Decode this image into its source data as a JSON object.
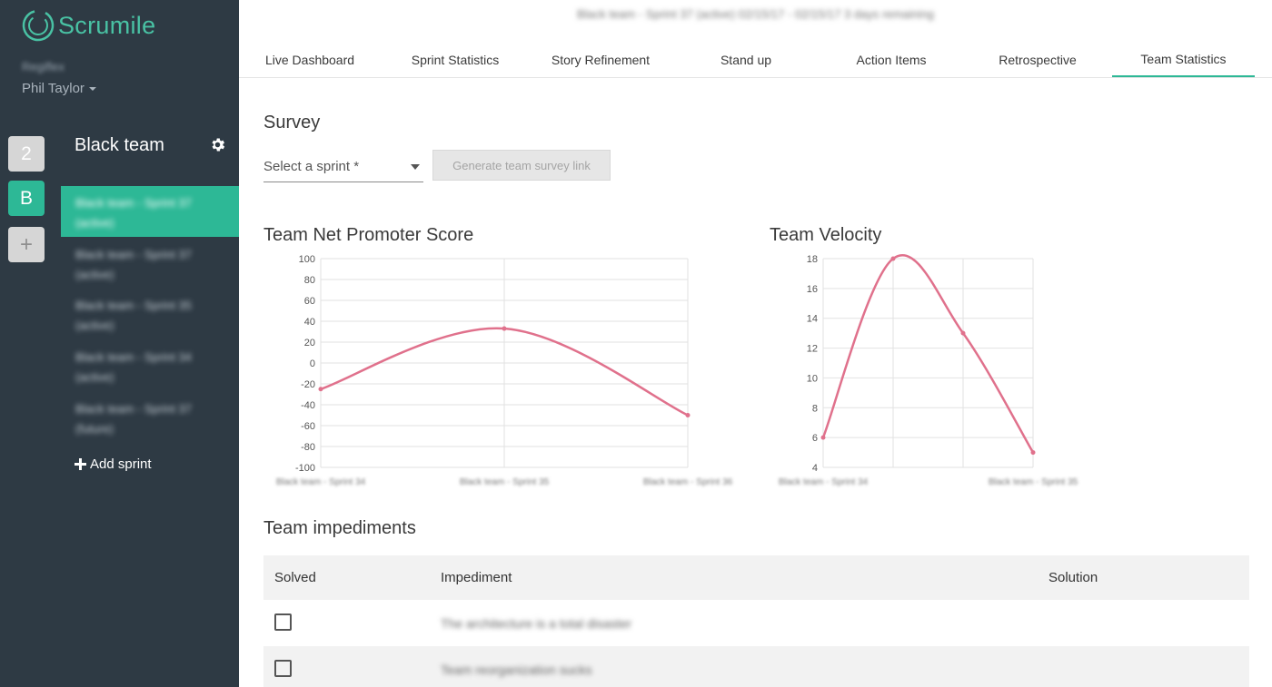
{
  "app": {
    "name": "Scrumile",
    "user_org": "Regiflex",
    "user_name": "Phil Taylor"
  },
  "rail": {
    "buttons": [
      "2",
      "B",
      "+"
    ]
  },
  "sidebar": {
    "team_name": "Black team",
    "sprints": [
      {
        "label": "Black team - Sprint 37 (active)"
      },
      {
        "label": "Black team - Sprint 37 (active)"
      },
      {
        "label": "Black team - Sprint 35 (active)"
      },
      {
        "label": "Black team - Sprint 34 (active)"
      },
      {
        "label": "Black team - Sprint 37 (future)"
      }
    ],
    "add_sprint": "Add sprint"
  },
  "header": {
    "sprint_info": "Black team - Sprint 37 (active)    02/15/17 - 02/15/17    3 days remaining",
    "tabs": [
      {
        "label": "Live Dashboard"
      },
      {
        "label": "Sprint Statistics"
      },
      {
        "label": "Story Refinement"
      },
      {
        "label": "Stand up"
      },
      {
        "label": "Action Items"
      },
      {
        "label": "Retrospective"
      },
      {
        "label": "Team Statistics",
        "active": true
      }
    ]
  },
  "survey": {
    "title": "Survey",
    "select_placeholder": "Select a sprint *",
    "button_label": "Generate team survey link"
  },
  "colors": {
    "accent": "#2db896",
    "sidebar_bg": "#2e3a44",
    "chart_line": "#e0718c"
  },
  "chart_data": [
    {
      "type": "line",
      "title": "Team Net Promoter Score",
      "x": [
        "Black team - Sprint 34",
        "Black team - Sprint 35",
        "Black team - Sprint 36"
      ],
      "series": [
        {
          "values": [
            -25,
            33,
            -50
          ]
        }
      ],
      "ylim": [
        -100,
        100
      ],
      "yticks": [
        100,
        80,
        60,
        40,
        20,
        0,
        -20,
        -40,
        -60,
        -80,
        -100
      ],
      "grid": true
    },
    {
      "type": "line",
      "title": "Team Velocity",
      "x": [
        "Black team - Sprint 34",
        "Black team - Sprint 35",
        "Black team - Sprint 36",
        "Black team - Sprint 37"
      ],
      "xtick_labels": [
        "Black team - Sprint 34",
        "",
        "",
        "Black team - Sprint 35"
      ],
      "series": [
        {
          "values": [
            6,
            18,
            13,
            5
          ]
        }
      ],
      "ylim": [
        4,
        18
      ],
      "yticks": [
        18,
        16,
        14,
        12,
        10,
        8,
        6,
        4
      ],
      "grid": true
    }
  ],
  "impediments": {
    "title": "Team impediments",
    "columns": [
      "Solved",
      "Impediment",
      "Solution"
    ],
    "rows": [
      {
        "impediment": "The architecture is a total disaster",
        "solution": ""
      },
      {
        "impediment": "Team reorganization sucks",
        "solution": ""
      }
    ]
  }
}
